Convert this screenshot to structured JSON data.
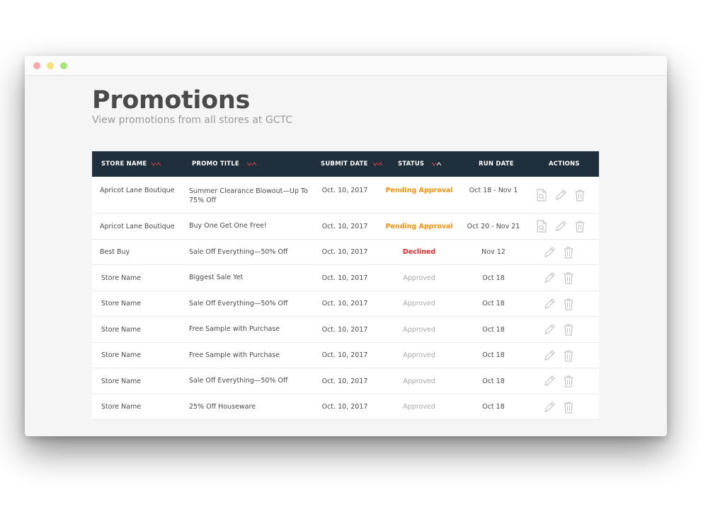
{
  "page": {
    "title": "Promotions",
    "subtitle": "View promotions from all stores at GCTC"
  },
  "colors": {
    "header_bg": "#1f2f3b",
    "sort_arrows": "#e0474c",
    "pending": "#f0920f",
    "declined": "#e02a2a",
    "approved": "#a8a8a8"
  },
  "table": {
    "headers": {
      "store_name": "STORE NAME",
      "promo_title": "PROMO TITLE",
      "submit_date": "SUBMIT DATE",
      "status": "STATUS",
      "run_date": "RUN DATE",
      "actions": "ACTIONS"
    },
    "rows": [
      {
        "store": "Apricot Lane Boutique",
        "promo": "Summer Clearance Blowout—Up To 75% Off",
        "submit": "Oct. 10, 2017",
        "status": "Pending Approval",
        "status_kind": "pending",
        "run": "Oct 18 - Nov 1",
        "actions": [
          "view-icon",
          "edit-icon",
          "delete-icon"
        ]
      },
      {
        "store": "Apricot Lane Boutique",
        "promo": "Buy One Get One Free!",
        "submit": "Oct. 10, 2017",
        "status": "Pending Approval",
        "status_kind": "pending",
        "run": "Oct 20 - Nov 21",
        "actions": [
          "view-icon",
          "edit-icon",
          "delete-icon"
        ]
      },
      {
        "store": "Best Buy",
        "promo": "Sale Off Everything—50% Off",
        "submit": "Oct. 10, 2017",
        "status": "Declined",
        "status_kind": "declined",
        "run": "Nov 12",
        "actions": [
          "edit-icon",
          "delete-icon"
        ]
      },
      {
        "store": "Store Name",
        "promo": "Biggest Sale Yet",
        "submit": "Oct. 10, 2017",
        "status": "Approved",
        "status_kind": "approved",
        "run": "Oct 18",
        "actions": [
          "edit-icon",
          "delete-icon"
        ]
      },
      {
        "store": "Store Name",
        "promo": "Sale Off Everything—50% Off",
        "submit": "Oct. 10, 2017",
        "status": "Approved",
        "status_kind": "approved",
        "run": "Oct 18",
        "actions": [
          "edit-icon",
          "delete-icon"
        ]
      },
      {
        "store": "Store Name",
        "promo": "Free Sample with Purchase",
        "submit": "Oct. 10, 2017",
        "status": "Approved",
        "status_kind": "approved",
        "run": "Oct 18",
        "actions": [
          "edit-icon",
          "delete-icon"
        ]
      },
      {
        "store": "Store Name",
        "promo": "Free Sample with Purchase",
        "submit": "Oct. 10, 2017",
        "status": "Approved",
        "status_kind": "approved",
        "run": "Oct 18",
        "actions": [
          "edit-icon",
          "delete-icon"
        ]
      },
      {
        "store": "Store Name",
        "promo": "Sale Off Everything—50% Off",
        "submit": "Oct. 10, 2017",
        "status": "Approved",
        "status_kind": "approved",
        "run": "Oct 18",
        "actions": [
          "edit-icon",
          "delete-icon"
        ]
      },
      {
        "store": "Store Name",
        "promo": "25% Off Houseware",
        "submit": "Oct. 10, 2017",
        "status": "Approved",
        "status_kind": "approved",
        "run": "Oct 18",
        "actions": [
          "edit-icon",
          "delete-icon"
        ]
      }
    ]
  }
}
